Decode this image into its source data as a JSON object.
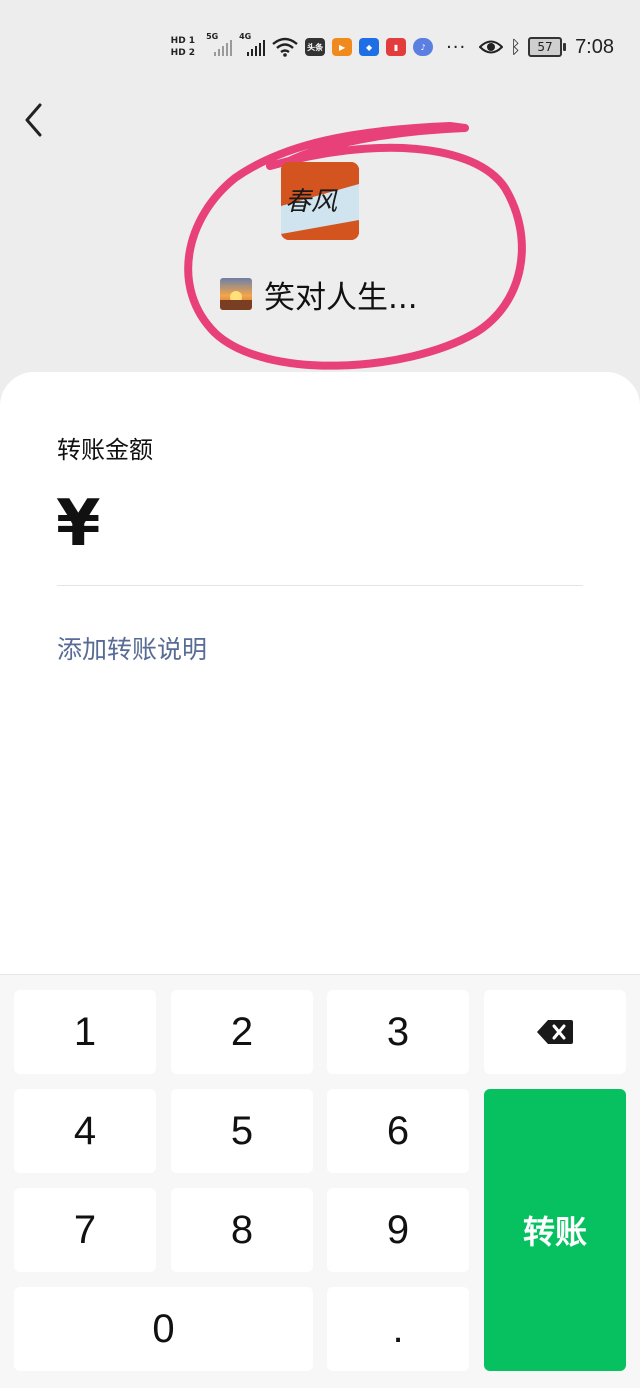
{
  "status_bar": {
    "hd1": "HD 1",
    "hd2": "HD 2",
    "net1": "5G",
    "net2": "4G",
    "app_badge": "头条",
    "battery": "57",
    "time": "7:08"
  },
  "header": {
    "recipient_name": "笑对人生...",
    "avatar_text": "春风"
  },
  "form": {
    "amount_label": "转账金额",
    "currency_symbol": "¥",
    "add_note": "添加转账说明"
  },
  "keypad": {
    "keys": [
      "1",
      "2",
      "3",
      "4",
      "5",
      "6",
      "7",
      "8",
      "9",
      "0",
      "."
    ],
    "transfer_label": "转账"
  },
  "colors": {
    "transfer_green": "#07c160",
    "link_blue": "#576b95",
    "annotation_pink": "#e8417a"
  }
}
